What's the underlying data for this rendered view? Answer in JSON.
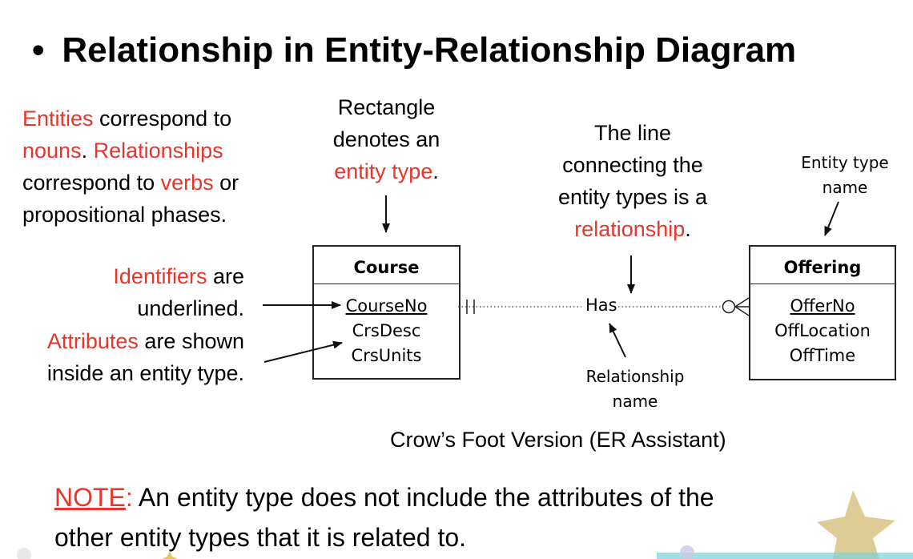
{
  "title": "Relationship in Entity-Relationship Diagram",
  "left_note": {
    "w1": "Entities",
    "w2": " correspond to",
    "w3": "nouns",
    "w4": ". ",
    "w5": "Relationships",
    "w6": "correspond to ",
    "w7": "verbs",
    "w8": " or",
    "w9": "propositional phases."
  },
  "identifiers_note": {
    "w1": "Identifiers",
    "w2": " are",
    "w3": "underlined."
  },
  "attributes_note": {
    "w1": "Attributes",
    "w2": " are shown",
    "w3": "inside an entity type."
  },
  "rectangle_note": {
    "l1": "Rectangle",
    "l2": "denotes an",
    "l3": "entity type",
    "l4": "."
  },
  "line_note": {
    "l1": "The line",
    "l2": "connecting the",
    "l3": "entity types is a",
    "l4": "relationship",
    "l5": "."
  },
  "entity_type_name_label": {
    "l1": "Entity type",
    "l2": "name"
  },
  "relationship_name_label": {
    "l1": "Relationship",
    "l2": "name"
  },
  "entities": {
    "course": {
      "name": "Course",
      "attributes": [
        "CourseNo",
        "CrsDesc",
        "CrsUnits"
      ]
    },
    "offering": {
      "name": "Offering",
      "attributes": [
        "OfferNo",
        "OffLocation",
        "OffTime"
      ]
    }
  },
  "relationship": {
    "name": "Has"
  },
  "caption": "Crow’s Foot Version (ER Assistant)",
  "bottom_note": {
    "label": "NOTE",
    "colon": ":",
    "line1": " An entity type does not include the attributes of the",
    "line2": "other entity types that it is related to."
  },
  "colors": {
    "accent": "#e8352b",
    "text": "#000000"
  }
}
